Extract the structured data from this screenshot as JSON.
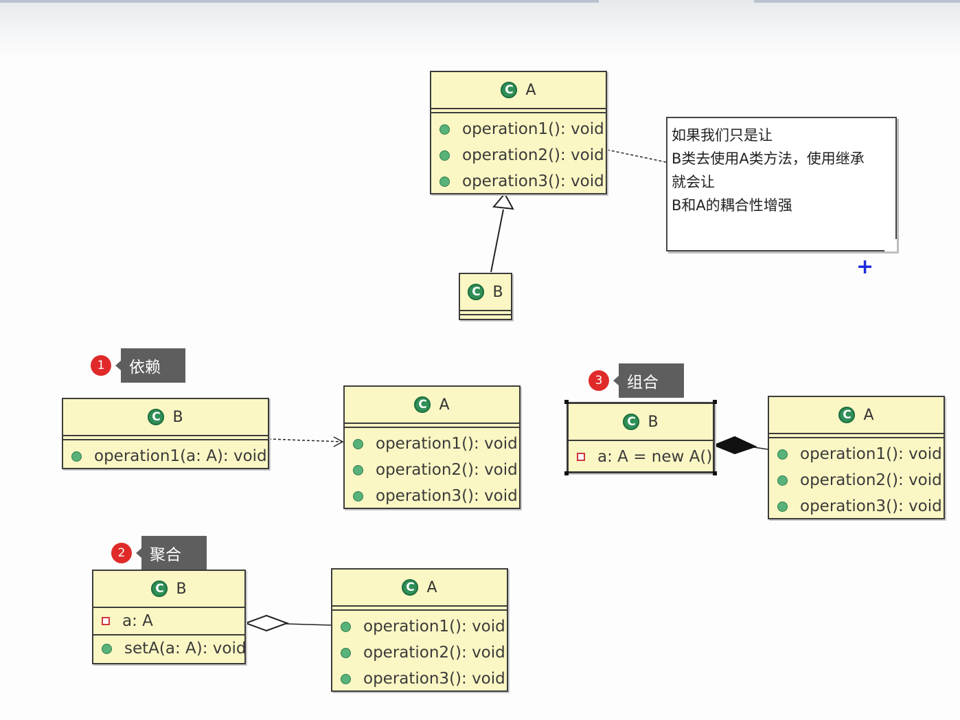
{
  "note": {
    "lines": [
      "如果我们只是让",
      "B类去使用A类方法，使用继承",
      "就会让",
      "B和A的耦合性增强"
    ]
  },
  "plus_symbol": "+",
  "class_icon": "C",
  "top": {
    "A": {
      "name": "A",
      "methods": [
        "operation1(): void",
        "operation2(): void",
        "operation3(): void"
      ]
    },
    "B": {
      "name": "B"
    }
  },
  "dependency": {
    "badge": "1",
    "label": "依赖",
    "B": {
      "name": "B",
      "methods": [
        "operation1(a: A): void"
      ]
    },
    "A": {
      "name": "A",
      "methods": [
        "operation1(): void",
        "operation2(): void",
        "operation3(): void"
      ]
    }
  },
  "aggregation": {
    "badge": "2",
    "label": "聚合",
    "B": {
      "name": "B",
      "fields": [
        "a: A"
      ],
      "methods": [
        "setA(a: A): void"
      ]
    },
    "A": {
      "name": "A",
      "methods": [
        "operation1(): void",
        "operation2(): void",
        "operation3(): void"
      ]
    }
  },
  "composition": {
    "badge": "3",
    "label": "组合",
    "B": {
      "name": "B",
      "fields": [
        "a: A = new A()"
      ]
    },
    "A": {
      "name": "A",
      "methods": [
        "operation1(): void",
        "operation2(): void",
        "operation3(): void"
      ]
    }
  },
  "colors": {
    "class_fill": "#fbf7c4",
    "class_border": "#3b3b3b",
    "class_icon": "#2f8f57",
    "method_dot": "#58b27a",
    "field_marker": "#d0343f",
    "badge": "#e02a2a",
    "callout": "#5e5e5e",
    "plus": "#1d2bdc"
  }
}
